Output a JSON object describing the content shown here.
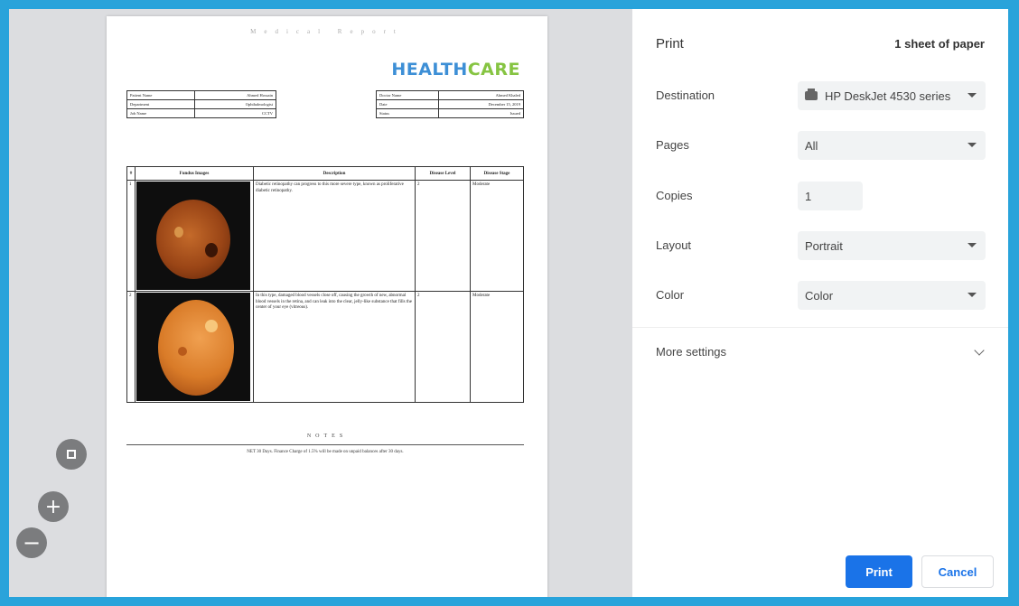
{
  "preview": {
    "report_title": "Medical Report",
    "logo": {
      "part1": "HEALTH",
      "part2": "CARE",
      "color1": "#3d8fd6",
      "color2": "#86c442"
    },
    "info_left": [
      {
        "label": "Patient Name",
        "value": "Ahmed Hossain"
      },
      {
        "label": "Department",
        "value": "Ophthalmologist"
      },
      {
        "label": "Job Name",
        "value": "CCTV"
      }
    ],
    "info_right": [
      {
        "label": "Doctor Name",
        "value": "Ahmed Khaled"
      },
      {
        "label": "Date",
        "value": "December 15, 2019"
      },
      {
        "label": "Status",
        "value": "Issued"
      }
    ],
    "table": {
      "headers": [
        "#",
        "Fundus Images",
        "Description",
        "Disease Level",
        "Disease Stage"
      ],
      "rows": [
        {
          "num": "1",
          "description": "Diabetic retinopathy can progress to this more severe type, known as proliferative diabetic retinopathy.",
          "level": "2",
          "stage": "Moderate"
        },
        {
          "num": "2",
          "description": "In this type, damaged blood vessels close off, causing the growth of new, abnormal blood vessels in the retina, and can leak into the clear, jelly-like substance that fills the center of your eye (vitreous).",
          "level": "2",
          "stage": "Moderate"
        }
      ]
    },
    "notes_title": "NOTES",
    "notes_text": "NET 30 Days. Finance Charge of 1.5% will be made on unpaid balances after 30 days."
  },
  "panel": {
    "title": "Print",
    "sheets": "1 sheet of paper",
    "destination": {
      "label": "Destination",
      "value": "HP DeskJet 4530 series"
    },
    "pages": {
      "label": "Pages",
      "value": "All"
    },
    "copies": {
      "label": "Copies",
      "value": "1"
    },
    "layout": {
      "label": "Layout",
      "value": "Portrait"
    },
    "color": {
      "label": "Color",
      "value": "Color"
    },
    "more_settings": "More settings",
    "print_button": "Print",
    "cancel_button": "Cancel",
    "accent": "#1a73e8"
  },
  "icons": [
    "fit-to-page-icon",
    "zoom-in-icon",
    "zoom-out-icon",
    "printer-icon",
    "chevron-down-icon"
  ]
}
